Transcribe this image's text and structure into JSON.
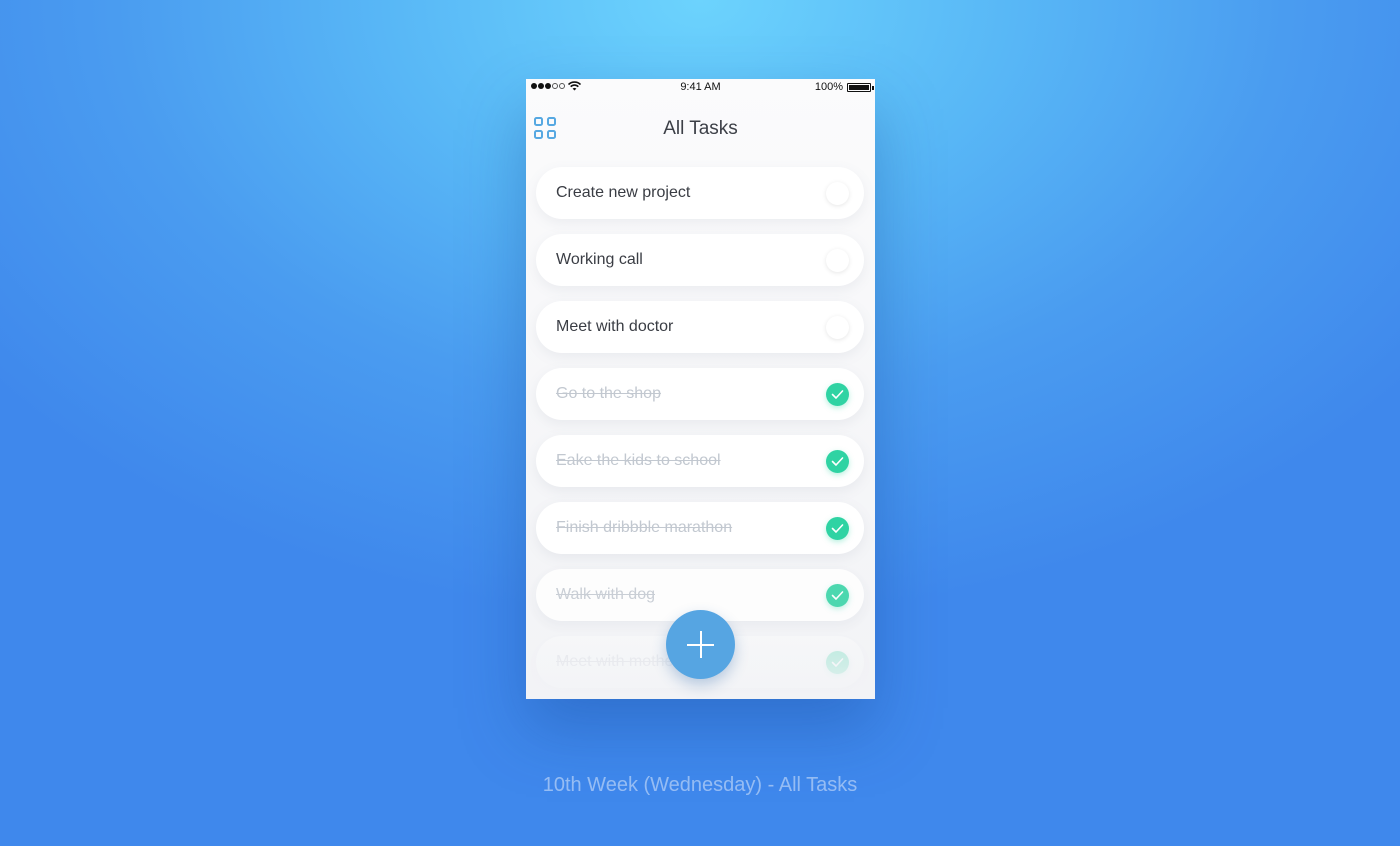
{
  "status_bar": {
    "signal_bars_filled": 3,
    "signal_bars_total": 5,
    "wifi_icon": "wifi-icon",
    "time": "9:41 AM",
    "battery_percent": "100%",
    "battery_icon": "battery-icon"
  },
  "header": {
    "menu_icon": "grid-icon",
    "title": "All Tasks"
  },
  "tasks": [
    {
      "label": "Create new project",
      "done": false
    },
    {
      "label": "Working call",
      "done": false
    },
    {
      "label": "Meet with doctor",
      "done": false
    },
    {
      "label": "Go to the shop",
      "done": true
    },
    {
      "label": "Eake the kids to school",
      "done": true
    },
    {
      "label": "Finish dribbble marathon",
      "done": true
    },
    {
      "label": "Walk with dog",
      "done": true
    },
    {
      "label": "Meet with mother",
      "done": true
    }
  ],
  "fab": {
    "icon": "plus-icon"
  },
  "caption": "10th Week (Wednesday) - All Tasks",
  "colors": {
    "accent": "#56a5e2",
    "done": "#2fd3a3"
  }
}
